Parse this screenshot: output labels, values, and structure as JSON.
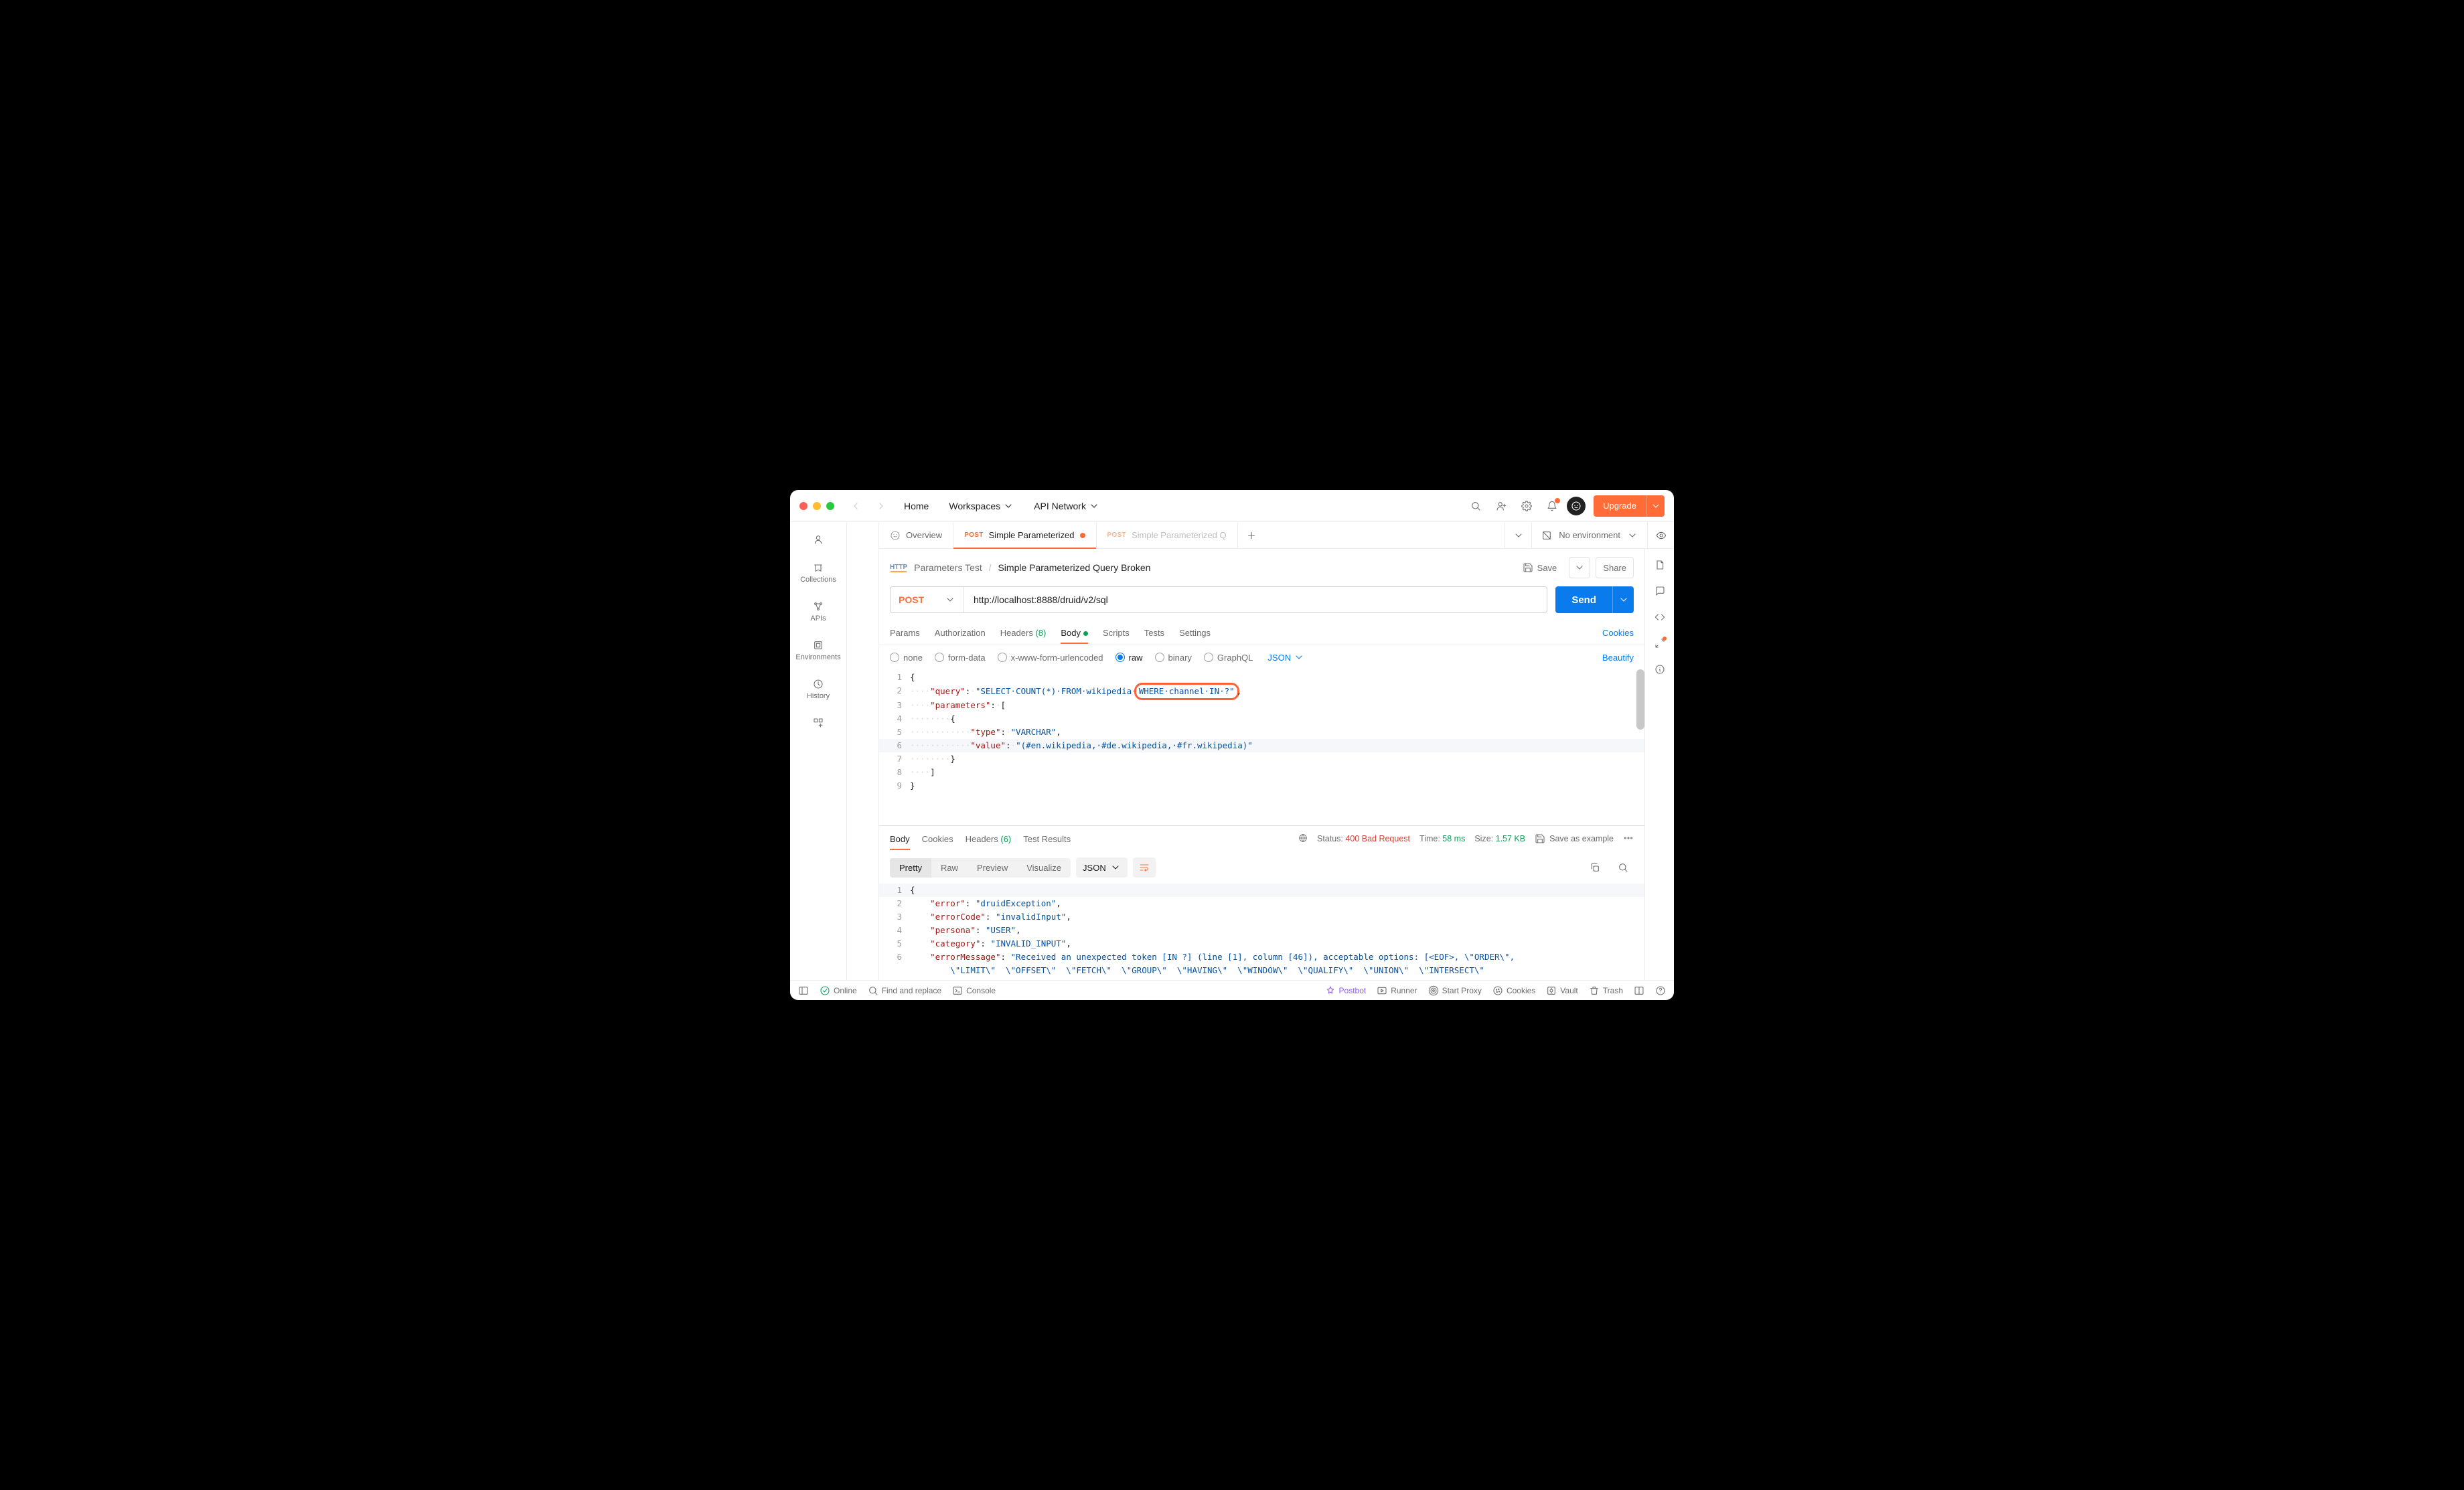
{
  "topbar": {
    "home": "Home",
    "workspaces": "Workspaces",
    "api_network": "API Network",
    "upgrade": "Upgrade"
  },
  "left_rail": {
    "collections": "Collections",
    "apis": "APIs",
    "environments": "Environments",
    "history": "History"
  },
  "tabs": {
    "overview": "Overview",
    "t1_method": "POST",
    "t1_label": "Simple Parameterized",
    "t2_method": "POST",
    "t2_label": "Simple Parameterized Q",
    "env_label": "No environment"
  },
  "breadcrumb": {
    "collection": "Parameters Test",
    "request": "Simple Parameterized Query Broken",
    "save": "Save",
    "share": "Share"
  },
  "request": {
    "method": "POST",
    "url": "http://localhost:8888/druid/v2/sql",
    "send": "Send"
  },
  "rtabs": {
    "params": "Params",
    "auth": "Authorization",
    "headers": "Headers",
    "headers_count": "(8)",
    "body": "Body",
    "scripts": "Scripts",
    "tests": "Tests",
    "settings": "Settings",
    "cookies": "Cookies"
  },
  "body_opts": {
    "none": "none",
    "form": "form-data",
    "url": "x-www-form-urlencoded",
    "raw": "raw",
    "binary": "binary",
    "graphql": "GraphQL",
    "lang": "JSON",
    "beautify": "Beautify"
  },
  "request_body_json": {
    "query": "SELECT COUNT(*) FROM wikipedia WHERE channel IN ?",
    "parameters": [
      {
        "type": "VARCHAR",
        "value": "(#en.wikipedia, #de.wikipedia, #fr.wikipedia)"
      }
    ]
  },
  "editor": {
    "query_key": "\"query\"",
    "query_pre": "\"SELECT·COUNT(*)·FROM·wikipedia·",
    "query_hl": "WHERE·channel·IN·?\"",
    "params_key": "\"parameters\"",
    "type_key": "\"type\"",
    "type_val": "\"VARCHAR\"",
    "value_key": "\"value\"",
    "value_val": "\"(#en.wikipedia,·#de.wikipedia,·#fr.wikipedia)\""
  },
  "response": {
    "tabs": {
      "body": "Body",
      "cookies": "Cookies",
      "headers": "Headers",
      "headers_count": "(6)",
      "tests": "Test Results"
    },
    "status_label": "Status:",
    "status_value": "400 Bad Request",
    "time_label": "Time:",
    "time_value": "58 ms",
    "size_label": "Size:",
    "size_value": "1.57 KB",
    "save_as": "Save as example",
    "view": {
      "pretty": "Pretty",
      "raw": "Raw",
      "preview": "Preview",
      "visualize": "Visualize",
      "lang": "JSON"
    }
  },
  "response_body_json": {
    "error": "druidException",
    "errorCode": "invalidInput",
    "persona": "USER",
    "category": "INVALID_INPUT",
    "errorMessage": "Received an unexpected token [IN ?] (line [1], column [46]), acceptable options: [<EOF>, \\\"ORDER\\\", \\\"LIMIT\\\", \\\"OFFSET\\\", \\\"FETCH\\\", \\\"GROUP\\\", \\\"HAVING\\\", \\\"WINDOW\\\", \\\"QUALIFY\\\", \\\"UNION\\\", \\\"INTERSECT\\\""
  },
  "resp_editor": {
    "error_k": "\"error\"",
    "error_v": "\"druidException\"",
    "code_k": "\"errorCode\"",
    "code_v": "\"invalidInput\"",
    "persona_k": "\"persona\"",
    "persona_v": "\"USER\"",
    "cat_k": "\"category\"",
    "cat_v": "\"INVALID_INPUT\"",
    "msg_k": "\"errorMessage\"",
    "msg_v1": "\"Received an unexpected token [IN ?] (line [1], column [46]), acceptable options: [<EOF>, \\\"ORDER\\\",",
    "msg_v2": "\\\"LIMIT\\\"  \\\"OFFSET\\\"  \\\"FETCH\\\"  \\\"GROUP\\\"  \\\"HAVING\\\"  \\\"WINDOW\\\"  \\\"QUALIFY\\\"  \\\"UNION\\\"  \\\"INTERSECT\\\""
  },
  "statusbar": {
    "online": "Online",
    "find": "Find and replace",
    "console": "Console",
    "postbot": "Postbot",
    "runner": "Runner",
    "proxy": "Start Proxy",
    "cookies": "Cookies",
    "vault": "Vault",
    "trash": "Trash"
  }
}
